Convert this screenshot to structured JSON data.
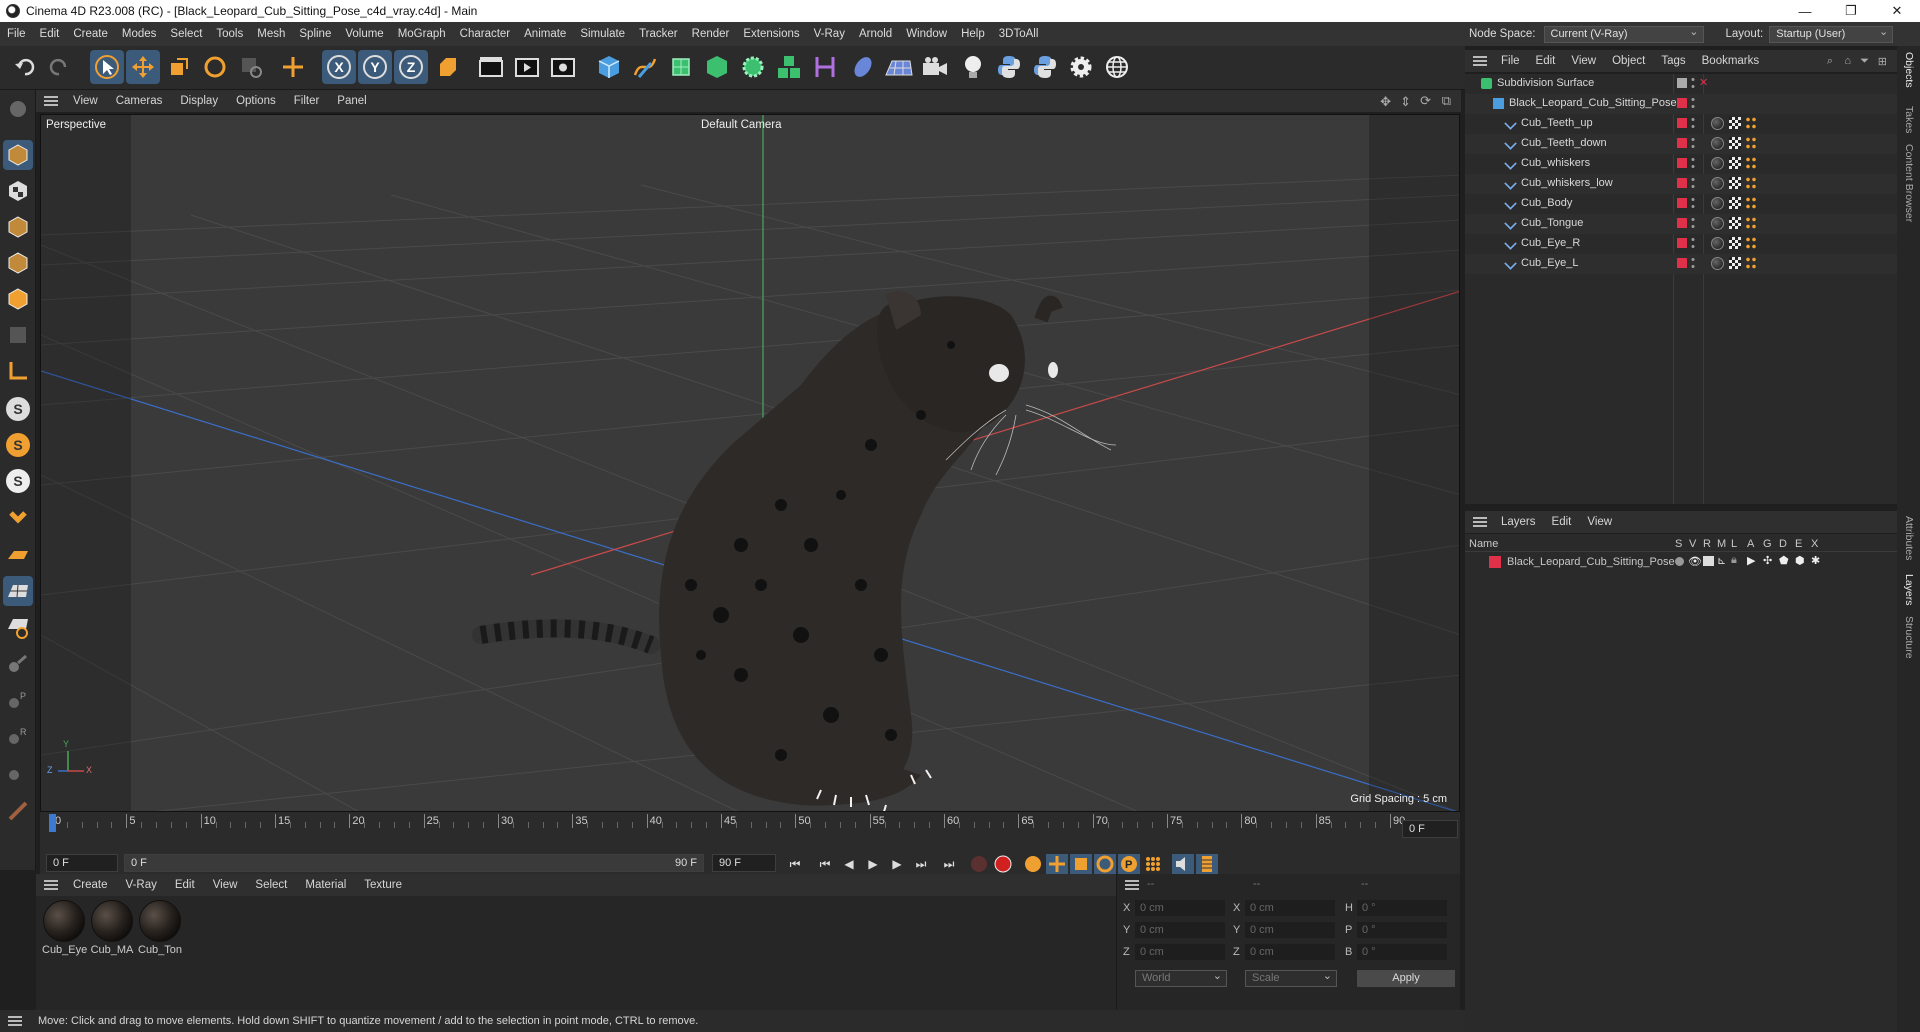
{
  "window": {
    "title": "Cinema 4D R23.008 (RC) - [Black_Leopard_Cub_Sitting_Pose_c4d_vray.c4d] - Main",
    "min": "—",
    "max": "❐",
    "close": "✕"
  },
  "menubar": [
    "File",
    "Edit",
    "Create",
    "Modes",
    "Select",
    "Tools",
    "Mesh",
    "Spline",
    "Volume",
    "MoGraph",
    "Character",
    "Animate",
    "Simulate",
    "Tracker",
    "Render",
    "Extensions",
    "V-Ray",
    "Arnold",
    "Window",
    "Help",
    "3DToAll"
  ],
  "nodespace": {
    "label": "Node Space:",
    "value": "Current (V-Ray)",
    "layout_label": "Layout:",
    "layout_value": "Startup (User)"
  },
  "viewport": {
    "menu": [
      "View",
      "Cameras",
      "Display",
      "Options",
      "Filter",
      "Panel"
    ],
    "name": "Perspective",
    "camera": "Default Camera",
    "grid_spacing": "Grid Spacing : 5 cm",
    "axis": {
      "y": "Y",
      "z": "Z",
      "x": "X"
    }
  },
  "timeline": {
    "ticks": [
      "0",
      "5",
      "10",
      "15",
      "20",
      "25",
      "30",
      "35",
      "40",
      "45",
      "50",
      "55",
      "60",
      "65",
      "70",
      "75",
      "80",
      "85",
      "90"
    ],
    "current_frame": "0 F",
    "start": "0 F",
    "range_start": "0 F",
    "range_end": "90 F",
    "end": "90 F"
  },
  "materials": {
    "menu": [
      "Create",
      "V-Ray",
      "Edit",
      "View",
      "Select",
      "Material",
      "Texture"
    ],
    "items": [
      {
        "label": "Cub_Eye"
      },
      {
        "label": "Cub_MA"
      },
      {
        "label": "Cub_Ton"
      }
    ]
  },
  "coords": {
    "headers": [
      "--",
      "--",
      "--"
    ],
    "rows": [
      {
        "a": "X",
        "av": "0 cm",
        "b": "X",
        "bv": "0 cm",
        "c": "H",
        "cv": "0 °"
      },
      {
        "a": "Y",
        "av": "0 cm",
        "b": "Y",
        "bv": "0 cm",
        "c": "P",
        "cv": "0 °"
      },
      {
        "a": "Z",
        "av": "0 cm",
        "b": "Z",
        "bv": "0 cm",
        "c": "B",
        "cv": "0 °"
      }
    ],
    "world": "World",
    "scale": "Scale",
    "apply": "Apply"
  },
  "status": "Move: Click and drag to move elements. Hold down SHIFT to quantize movement / add to the selection in point mode, CTRL to remove.",
  "objects": {
    "menu": [
      "File",
      "Edit",
      "View",
      "Object",
      "Tags",
      "Bookmarks"
    ],
    "items": [
      {
        "name": "Subdivision Surface",
        "indent": 0
      },
      {
        "name": "Black_Leopard_Cub_Sitting_Pose",
        "indent": 1
      },
      {
        "name": "Cub_Teeth_up",
        "indent": 2
      },
      {
        "name": "Cub_Teeth_down",
        "indent": 2
      },
      {
        "name": "Cub_whiskers",
        "indent": 2
      },
      {
        "name": "Cub_whiskers_low",
        "indent": 2
      },
      {
        "name": "Cub_Body",
        "indent": 2
      },
      {
        "name": "Cub_Tongue",
        "indent": 2
      },
      {
        "name": "Cub_Eye_R",
        "indent": 2
      },
      {
        "name": "Cub_Eye_L",
        "indent": 2
      }
    ]
  },
  "layers": {
    "menu": [
      "Layers",
      "Edit",
      "View"
    ],
    "columns": [
      "Name",
      "S",
      "V",
      "R",
      "M",
      "L",
      "A",
      "G",
      "D",
      "E",
      "X"
    ],
    "items": [
      {
        "name": "Black_Leopard_Cub_Sitting_Pose",
        "color": "#e0304a"
      }
    ]
  },
  "sidetabs": [
    "Objects",
    "Takes",
    "Content Browser",
    "Attributes",
    "Layers",
    "Structure"
  ],
  "colors": {
    "accent": "#3c5a7a",
    "layer_red": "#e0304a",
    "x_axis": "#c84a4a",
    "y_axis": "#4aa85a",
    "z_axis": "#3a6ec8"
  }
}
